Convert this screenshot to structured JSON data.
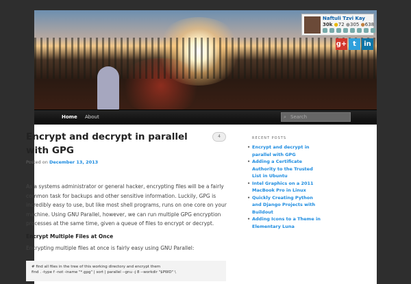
{
  "header": {
    "badge": {
      "name": "Naftuli Tzvi Kay",
      "reputation": "30k",
      "gold": "72",
      "silver": "305",
      "bronze": "638"
    },
    "social": [
      {
        "name": "google-plus",
        "label": "g+",
        "color": "#d3382d"
      },
      {
        "name": "twitter",
        "label": "t",
        "color": "#2fa0dc"
      },
      {
        "name": "linkedin",
        "label": "in",
        "color": "#0e76a8"
      }
    ]
  },
  "nav": {
    "items": [
      "Home",
      "About"
    ],
    "search_placeholder": "Search"
  },
  "post": {
    "title": "Encrypt and decrypt in parallel with GPG",
    "comments": "4",
    "posted_on": "Posted on",
    "date": "December 13, 2013",
    "intro": "As a systems administrator or general hacker, encrypting files will be a fairly common task for backups and other sensitive information. Luckily, GPG is incredibly easy to use, but like most shell programs, runs on one core on your machine. Using GNU Parallel, however, we can run multiple GPG encryption processes at the same time, given a queue of files to encrypt or decrypt.",
    "heading": "Encrypt Multiple Files at Once",
    "lead": "Encrypting multiple files at once is fairly easy using GNU Parallel:",
    "code": [
      "# find all files in the tree of this working directory and encrypt them",
      "find . -type f -not -iname \"*.gpg\" | sort | parallel --gnu -j 8 --workdir \"$PWD\" \\"
    ]
  },
  "sidebar": {
    "heading": "RECENT POSTS",
    "posts": [
      "Encrypt and decrypt in parallel with GPG",
      "Adding a Certificate Authority to the Trusted List in Ubuntu",
      "Intel Graphics on a 2011 MacBook Pro in Linux",
      "Quickly Creating Python and Django Projects with Buildout",
      "Adding Icons to a Theme in Elementary Luna"
    ]
  }
}
